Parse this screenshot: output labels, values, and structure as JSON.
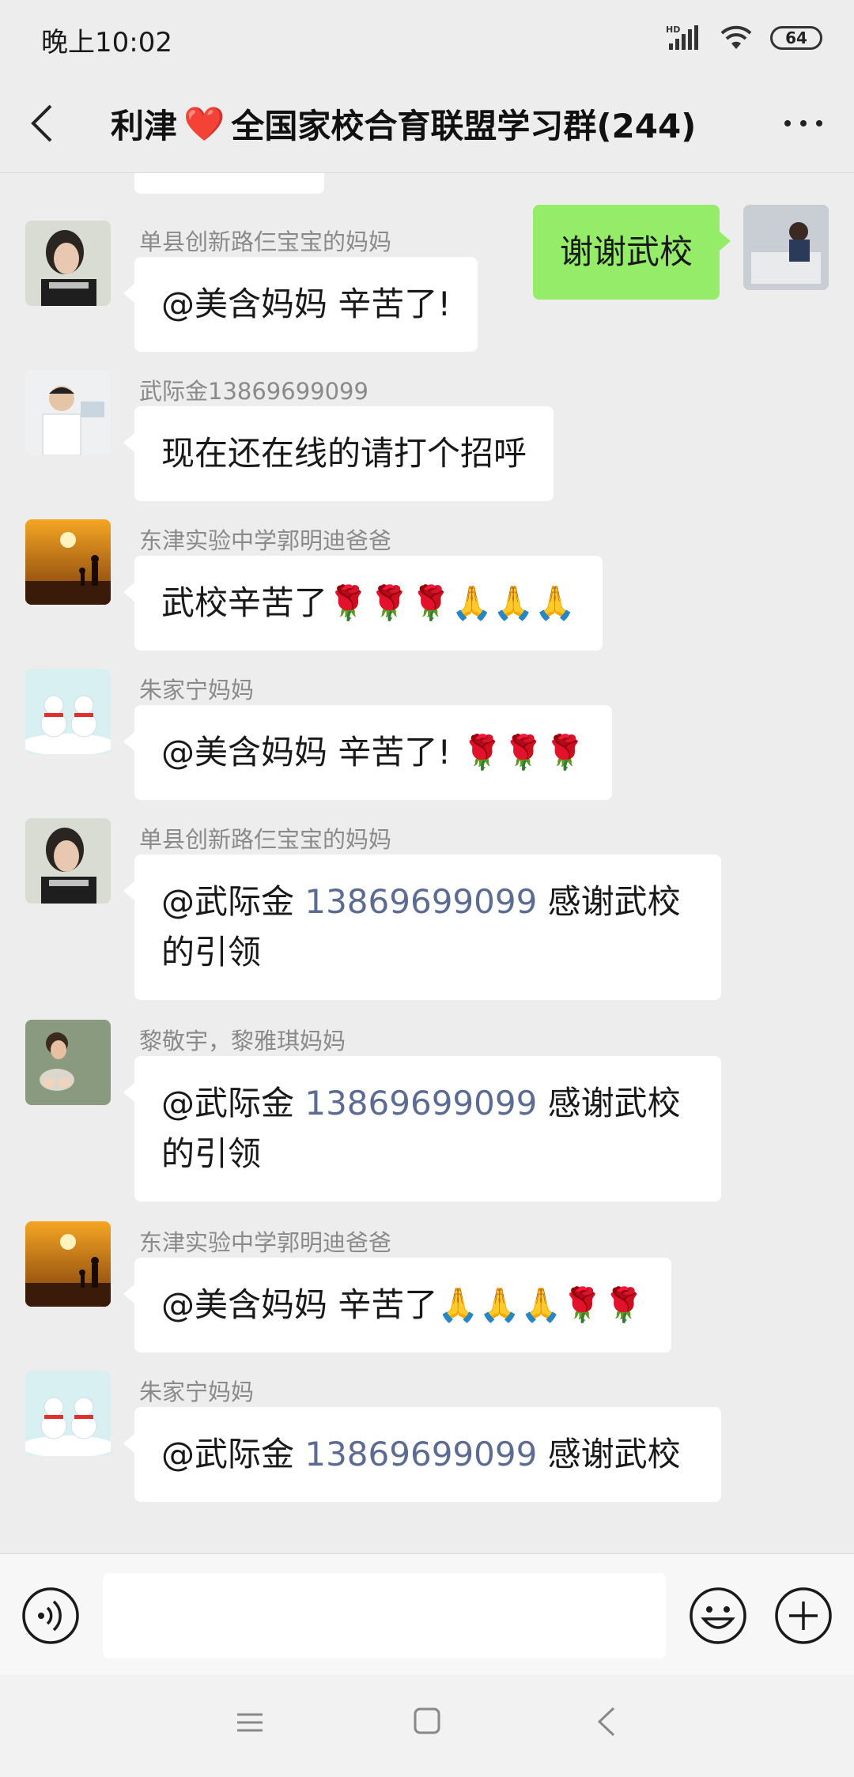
{
  "status_bar": {
    "time": "晚上10:02",
    "hd_label": "HD",
    "battery_level": "64"
  },
  "title_bar": {
    "title_part1": "利津",
    "heart_emoji": "❤️",
    "title_part2": "全国家校合育联盟学习群(244)"
  },
  "messages": [
    {
      "type": "self",
      "text": "谢谢武校"
    },
    {
      "type": "other",
      "sender": "单县创新路仨宝宝的妈妈",
      "avatar": "woman-portrait",
      "text": "@美含妈妈  辛苦了!"
    },
    {
      "type": "other",
      "sender": "武际金13869699099",
      "avatar": "man-portrait",
      "text": "现在还在线的请打个招呼"
    },
    {
      "type": "other",
      "sender": "东津实验中学郭明迪爸爸",
      "avatar": "sunset-silhouette",
      "text": "武校辛苦了🌹🌹🌹🙏🙏🙏"
    },
    {
      "type": "other",
      "sender": "朱家宁妈妈",
      "avatar": "snowmen",
      "text": "@美含妈妈  辛苦了! 🌹🌹🌹"
    },
    {
      "type": "other",
      "sender": "单县创新路仨宝宝的妈妈",
      "avatar": "woman-portrait",
      "text_prefix": "@武际金 ",
      "text_link": "13869699099",
      "text_suffix": " 感谢武校",
      "text_line2": "的引领"
    },
    {
      "type": "other",
      "sender": "黎敬宇，黎雅琪妈妈",
      "avatar": "child-water",
      "text_prefix": "@武际金 ",
      "text_link": "13869699099",
      "text_suffix": " 感谢武校",
      "text_line2": "的引领"
    },
    {
      "type": "other",
      "sender": "东津实验中学郭明迪爸爸",
      "avatar": "sunset-silhouette",
      "text": "@美含妈妈  辛苦了🙏🙏🙏🌹🌹"
    },
    {
      "type": "other",
      "sender": "朱家宁妈妈",
      "avatar": "snowmen",
      "text_prefix": "@武际金 ",
      "text_link": "13869699099",
      "text_suffix": " 感谢武校"
    }
  ],
  "colors": {
    "background": "#ededed",
    "self_bubble": "#95ec69",
    "other_bubble": "#ffffff",
    "sender_name": "#8a8a8a",
    "link": "#5b6b92"
  }
}
